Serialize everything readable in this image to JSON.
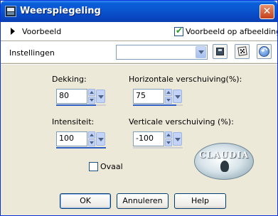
{
  "window": {
    "title": "Weerspiegeling",
    "app_icon": "paint-shop-pro-icon",
    "close_glyph": "✕"
  },
  "preview": {
    "toggle_label": "Voorbeeld",
    "on_image_label": "Voorbeeld op afbeelding",
    "on_image_checked": true,
    "check_glyph": "✔"
  },
  "settings": {
    "label": "Instellingen",
    "preset_value": "",
    "tool_icons": [
      "save-preset-icon",
      "randomize-dice-icon",
      "reset-icon"
    ]
  },
  "fields": {
    "dekking": {
      "label": "Dekking:",
      "value": "80",
      "slider_percent": 80
    },
    "horizontaal": {
      "label": "Horizontale verschuiving(%):",
      "value": "75",
      "slider_percent": 87
    },
    "intensiteit": {
      "label": "Intensiteit:",
      "value": "100",
      "slider_percent": 100
    },
    "verticaal": {
      "label": "Verticale verschuiving (%):",
      "value": "-100",
      "slider_percent": 0
    }
  },
  "ovaal": {
    "label": "Ovaal",
    "checked": false
  },
  "watermark": {
    "text": "CLAUDIA"
  },
  "buttons": {
    "ok": "OK",
    "cancel": "Annuleren",
    "help": "Help"
  },
  "colors": {
    "title_bar": "#0a55d0",
    "dialog_bg": "#ece9d8",
    "accent": "#2e5ec8"
  }
}
